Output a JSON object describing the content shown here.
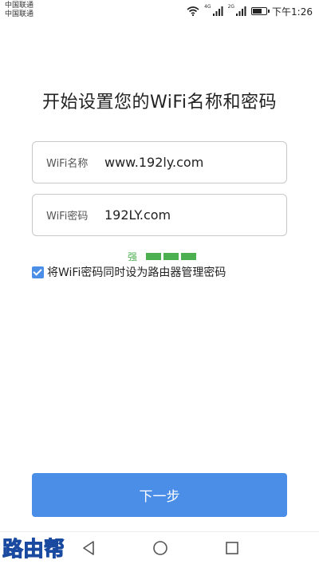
{
  "status_bar": {
    "carrier_line1": "中国联通",
    "carrier_line2": "中国联通",
    "net1": "4G",
    "net2": "2G",
    "time": "下午1:26",
    "battery_level": 0.75
  },
  "page": {
    "title": "开始设置您的WiFi名称和密码"
  },
  "form": {
    "wifi_name_label": "WiFi名称",
    "wifi_name_value": "www.192ly.com",
    "wifi_password_label": "WiFi密码",
    "wifi_password_value": "192LY.com",
    "strength_label": "强",
    "strength_level": 3,
    "sync_admin_checked": true,
    "sync_admin_label": "将WiFi密码同时设为路由器管理密码"
  },
  "actions": {
    "next_label": "下一步"
  },
  "watermark": {
    "text": "路由帮"
  },
  "colors": {
    "accent": "#4a8ee8",
    "strength": "#4caf50"
  },
  "icons": [
    "wifi-icon",
    "signal-icon",
    "battery-icon",
    "back-icon",
    "home-icon",
    "recent-apps-icon"
  ]
}
